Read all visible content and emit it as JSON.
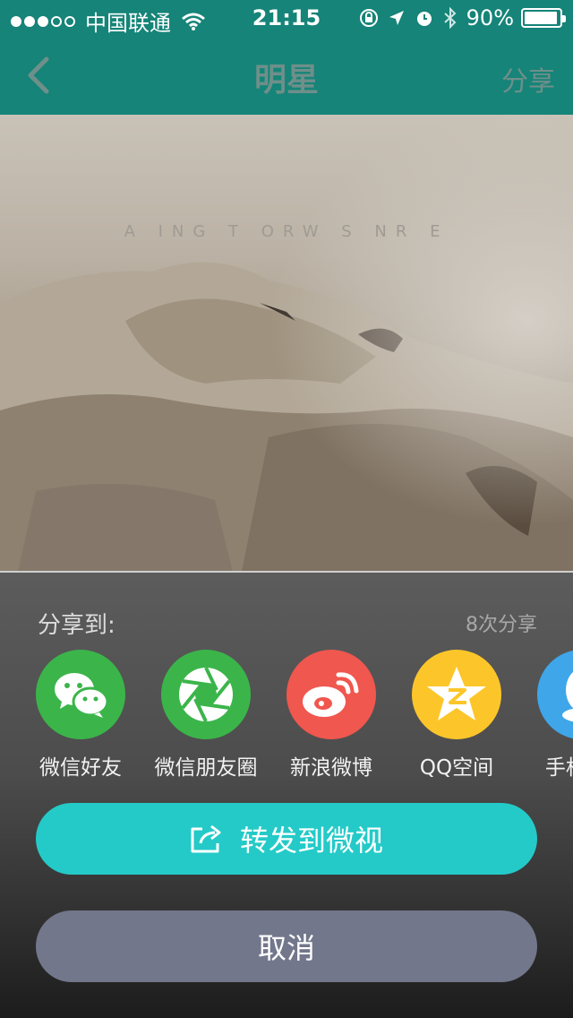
{
  "status_bar": {
    "carrier": "中国联通",
    "time": "21:15",
    "battery": "90%",
    "signal_dots_filled": 3,
    "signal_dots_total": 5
  },
  "nav": {
    "back_icon": "chevron-left-icon",
    "title": "明星",
    "share": "分享"
  },
  "video": {
    "overlay_text": "A ING T ORW S NR E"
  },
  "share_sheet": {
    "title": "分享到:",
    "count": "8次分享",
    "targets": [
      {
        "label": "微信好友",
        "icon": "wechat-icon",
        "color": "#3bb54a"
      },
      {
        "label": "微信朋友圈",
        "icon": "moments-icon",
        "color": "#3bb54a"
      },
      {
        "label": "新浪微博",
        "icon": "weibo-icon",
        "color": "#f0574e"
      },
      {
        "label": "QQ空间",
        "icon": "qzone-icon",
        "color": "#fcc62a"
      },
      {
        "label": "手机QQ",
        "icon": "qq-icon",
        "color": "#3fa6ea"
      }
    ],
    "forward_button": "转发到微视",
    "cancel_button": "取消"
  },
  "colors": {
    "nav_bar": "#168478",
    "accent": "#24cac8",
    "cancel": "#73778b"
  }
}
